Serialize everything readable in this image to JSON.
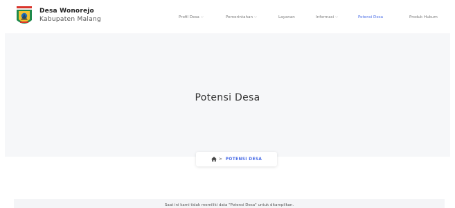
{
  "brand": {
    "name": "Desa Wonorejo",
    "subtitle": "Kabupaten Malang",
    "logo_icon": "regency-emblem-icon"
  },
  "nav": {
    "items": [
      {
        "label": "Profil Desa",
        "dropdown": true,
        "active": false
      },
      {
        "label": "Pemerintahan",
        "dropdown": true,
        "active": false
      },
      {
        "label": "Layanan",
        "dropdown": false,
        "active": false
      },
      {
        "label": "Informasi",
        "dropdown": true,
        "active": false
      },
      {
        "label": "Potensi Desa",
        "dropdown": false,
        "active": true
      },
      {
        "label": "Produk Hukum",
        "dropdown": false,
        "active": false
      }
    ],
    "chevron_icon": "chevron-down-icon"
  },
  "hero": {
    "title": "Potensi Desa"
  },
  "breadcrumb": {
    "home_icon": "home-icon",
    "separator": ">",
    "current": "POTENSI DESA"
  },
  "notice": {
    "text": "Saat ini kami tidak memiliki data \"Potensi Desa\" untuk ditampilkan."
  },
  "colors": {
    "accent": "#4b6ee6",
    "hero_bg": "#f6f7f9",
    "text_muted": "#7a7a7a"
  }
}
